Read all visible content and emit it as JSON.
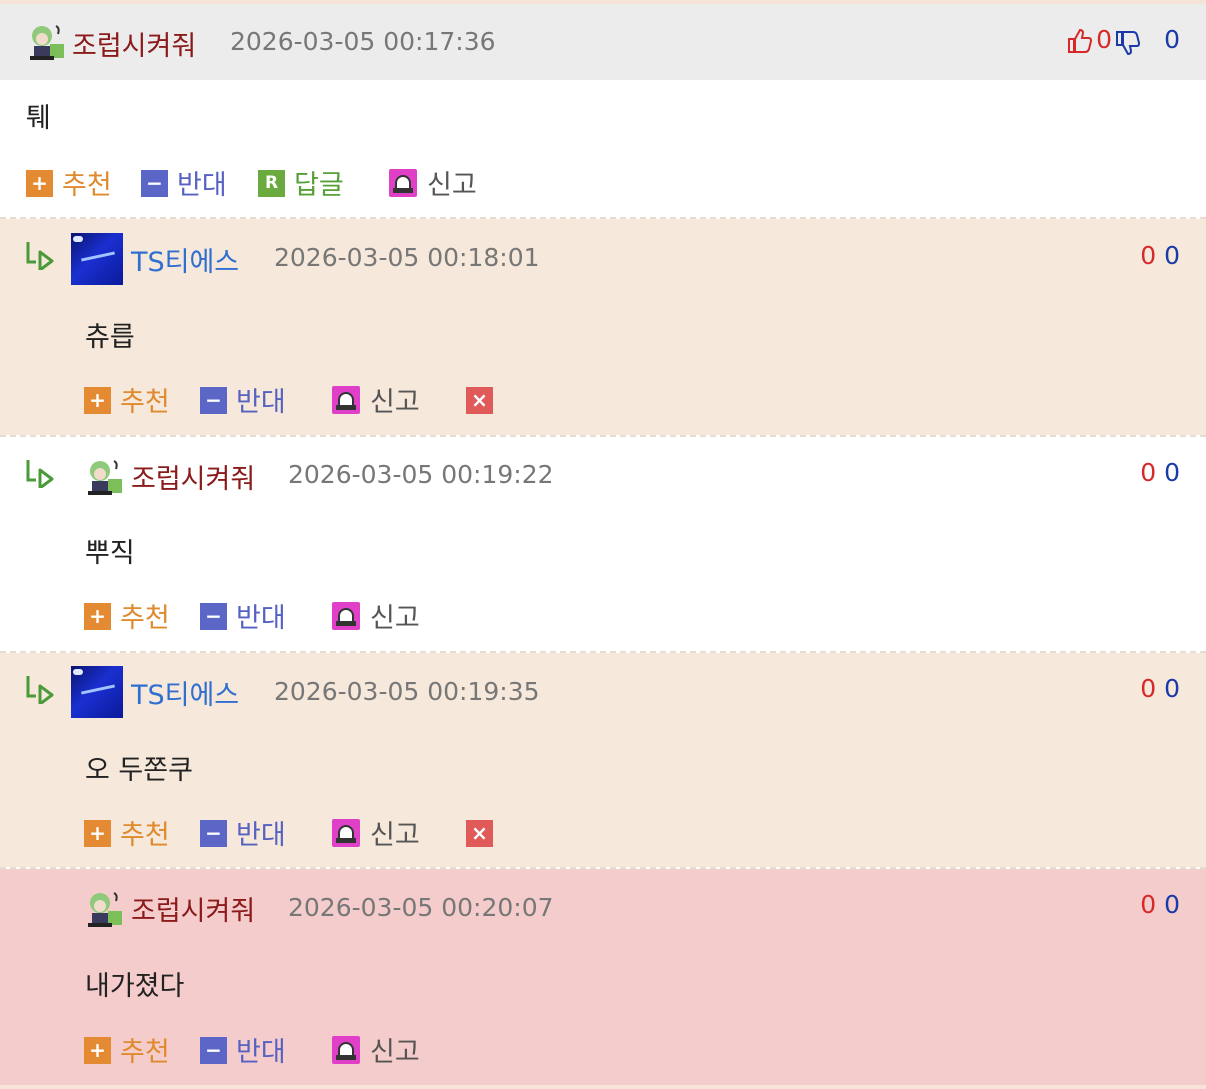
{
  "comments": [
    {
      "author": "조럽시켜줘",
      "date": "2026-03-05 00:17:36",
      "body": "퉤",
      "votes_up": "0",
      "votes_down": "0",
      "actions": {
        "recommend": "추천",
        "oppose": "반대",
        "reply": "답글",
        "report": "신고"
      }
    },
    {
      "author": "TS티에스",
      "date": "2026-03-05 00:18:01",
      "body": "츄릅",
      "votes_up": "0",
      "votes_down": "0",
      "actions": {
        "recommend": "추천",
        "oppose": "반대",
        "report": "신고"
      }
    },
    {
      "author": "조럽시켜줘",
      "date": "2026-03-05 00:19:22",
      "body": "뿌직",
      "votes_up": "0",
      "votes_down": "0",
      "actions": {
        "recommend": "추천",
        "oppose": "반대",
        "report": "신고"
      }
    },
    {
      "author": "TS티에스",
      "date": "2026-03-05 00:19:35",
      "body": "오 두쫀쿠",
      "votes_up": "0",
      "votes_down": "0",
      "actions": {
        "recommend": "추천",
        "oppose": "반대",
        "report": "신고"
      }
    },
    {
      "author": "조럽시켜줘",
      "date": "2026-03-05 00:20:07",
      "body": "내가졌다",
      "votes_up": "0",
      "votes_down": "0",
      "actions": {
        "recommend": "추천",
        "oppose": "반대",
        "report": "신고"
      }
    }
  ],
  "icons": {
    "recommend": "plus-square-icon",
    "oppose": "minus-square-icon",
    "reply": "reply-r-icon",
    "report": "siren-icon",
    "delete": "delete-x-icon",
    "thumb_up": "thumbs-up-icon",
    "thumb_down": "thumbs-down-icon",
    "reply_marker": "reply-arrow-icon"
  },
  "colors": {
    "recommend": "#e38a32",
    "oppose": "#5b66c6",
    "reply": "#6aaa3e",
    "delete": "#e05a5a",
    "vote_up": "#d62a2a",
    "vote_down": "#1a3aa8",
    "author_kr": "#8b1a1a",
    "author_ts": "#2f6fd0",
    "header_bg": "#ececec",
    "reply_bg": "#f6e8da",
    "highlight_bg": "#f5cccc"
  }
}
